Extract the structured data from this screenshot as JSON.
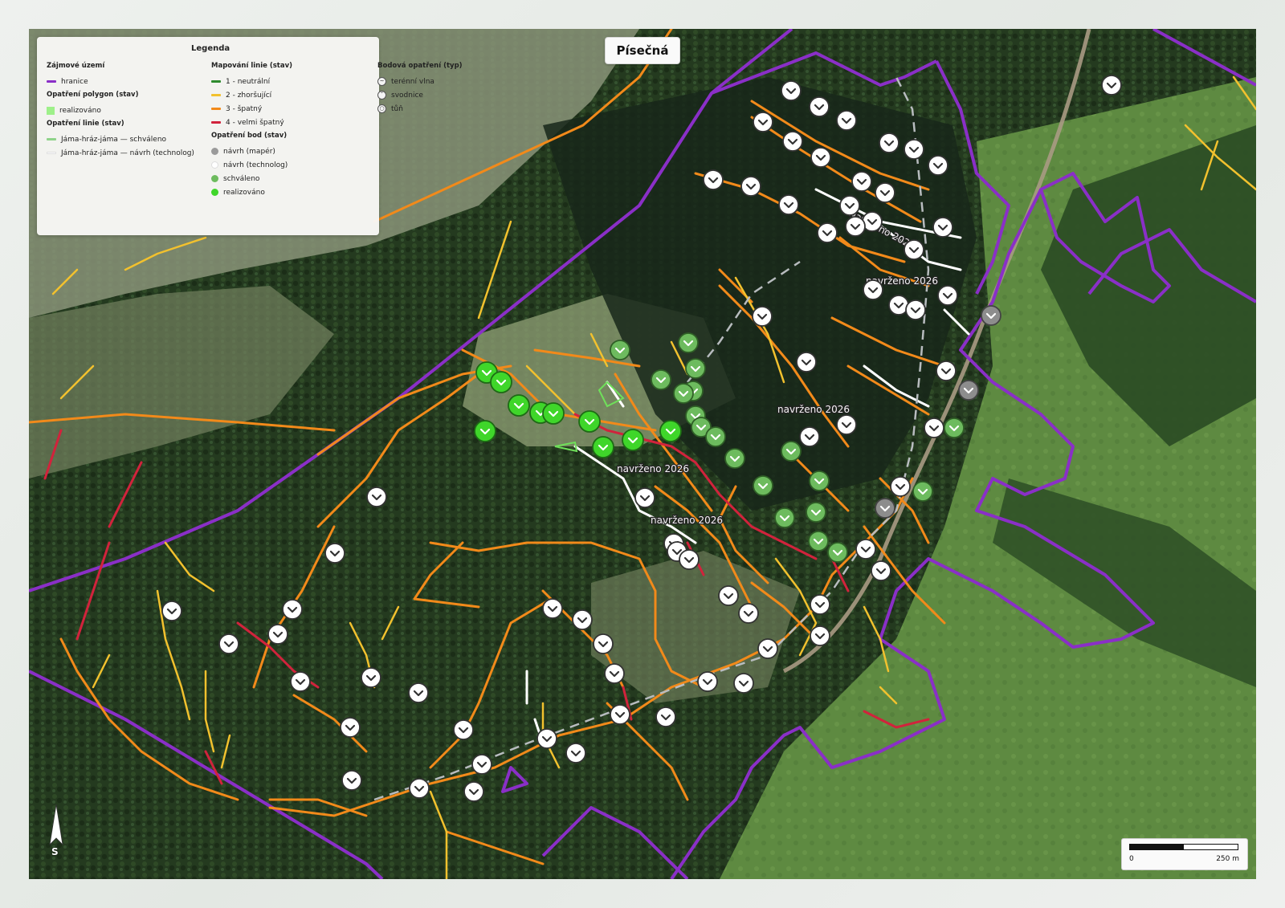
{
  "title": "Písečná",
  "legend": {
    "heading": "Legenda",
    "area": {
      "title": "Zájmové území",
      "items": [
        {
          "label": "hranice",
          "color": "#8a2fc7"
        }
      ]
    },
    "polygon": {
      "title": "Opatření polygon (stav)",
      "items": [
        {
          "label": "realizováno",
          "color": "#9ef08a"
        }
      ]
    },
    "measure_lines": {
      "title": "Opatření linie (stav)",
      "items": [
        {
          "label": "Jáma-hráz-jáma — schváleno",
          "color": "#8fd38a"
        },
        {
          "label": "Jáma-hráz-jáma — návrh (technolog)",
          "color": "#ffffff"
        }
      ]
    },
    "mapping_lines": {
      "title": "Mapování linie (stav)",
      "items": [
        {
          "label": "1 - neutrální",
          "color": "#2e8b2e"
        },
        {
          "label": "2 - zhoršující",
          "color": "#f2c12e"
        },
        {
          "label": "3 - špatný",
          "color": "#f28a1a"
        },
        {
          "label": "4 - velmi špatný",
          "color": "#d1233c"
        }
      ]
    },
    "point_state": {
      "title": "Opatření bod (stav)",
      "items": [
        {
          "label": "návrh (mapér)",
          "color": "#9a9a9a"
        },
        {
          "label": "návrh (technolog)",
          "color": "#ffffff"
        },
        {
          "label": "schváleno",
          "color": "#6dbb5e"
        },
        {
          "label": "realizováno",
          "color": "#3fd62a"
        }
      ]
    },
    "point_type": {
      "title": "Bodová opatření (typ)",
      "items": [
        {
          "label": "terénní vlna",
          "icon": "wave-icon"
        },
        {
          "label": "svodnice",
          "icon": "chevron-icon"
        },
        {
          "label": "tůň",
          "icon": "pond-icon"
        }
      ]
    }
  },
  "map_labels": [
    "Navrženo 2026",
    "navrženo 2026",
    "navrženo 2026",
    "navrženo 2026",
    "navrženo 2026"
  ],
  "north_label": "S",
  "scale": {
    "start": "0",
    "end": "250 m"
  }
}
